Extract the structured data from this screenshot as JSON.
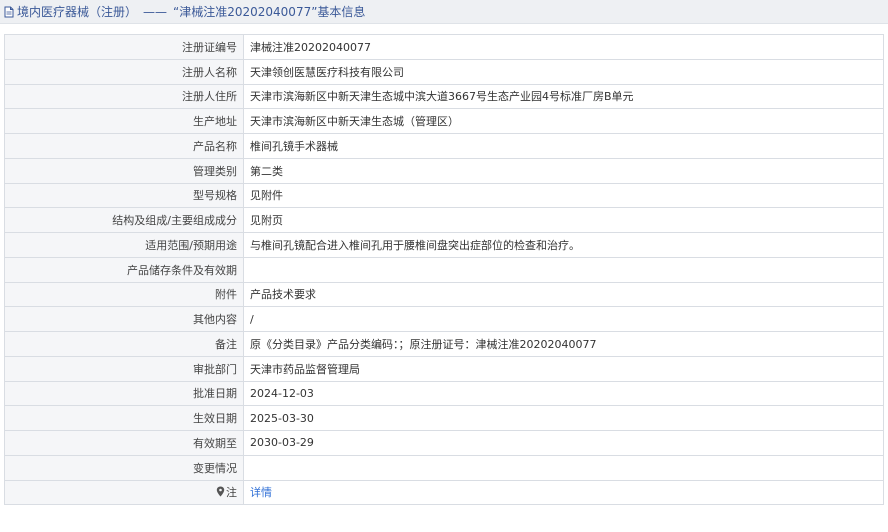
{
  "header": {
    "category": "境内医疗器械（注册）",
    "separator": "——",
    "record_title": "“津械注准20202040077”基本信息"
  },
  "rows": [
    {
      "label": "注册证编号",
      "value": "津械注准20202040077"
    },
    {
      "label": "注册人名称",
      "value": "天津领创医慧医疗科技有限公司"
    },
    {
      "label": "注册人住所",
      "value": "天津市滨海新区中新天津生态城中滨大道3667号生态产业园4号标准厂房B单元"
    },
    {
      "label": "生产地址",
      "value": "天津市滨海新区中新天津生态城（管理区）"
    },
    {
      "label": "产品名称",
      "value": "椎间孔镜手术器械"
    },
    {
      "label": "管理类别",
      "value": "第二类"
    },
    {
      "label": "型号规格",
      "value": "见附件"
    },
    {
      "label": "结构及组成/主要组成成分",
      "value": "见附页"
    },
    {
      "label": "适用范围/预期用途",
      "value": "与椎间孔镜配合进入椎间孔用于腰椎间盘突出症部位的检查和治疗。"
    },
    {
      "label": "产品储存条件及有效期",
      "value": ""
    },
    {
      "label": "附件",
      "value": "产品技术要求"
    },
    {
      "label": "其他内容",
      "value": "/"
    },
    {
      "label": "备注",
      "value": "原《分类目录》产品分类编码：；原注册证号：津械注准20202040077"
    },
    {
      "label": "审批部门",
      "value": "天津市药品监督管理局"
    },
    {
      "label": "批准日期",
      "value": "2024-12-03"
    },
    {
      "label": "生效日期",
      "value": "2025-03-30"
    },
    {
      "label": "有效期至",
      "value": "2030-03-29"
    },
    {
      "label": "变更情况",
      "value": ""
    }
  ],
  "note_row": {
    "label": "注",
    "link_text": "详情"
  },
  "icons": {
    "title_icon": "document-icon",
    "note_icon": "map-pin-icon"
  },
  "colors": {
    "link": "#2f6fd6",
    "title": "#3b5998",
    "label_bg": "#f5f6f8",
    "header_bg": "#eef0f3"
  }
}
